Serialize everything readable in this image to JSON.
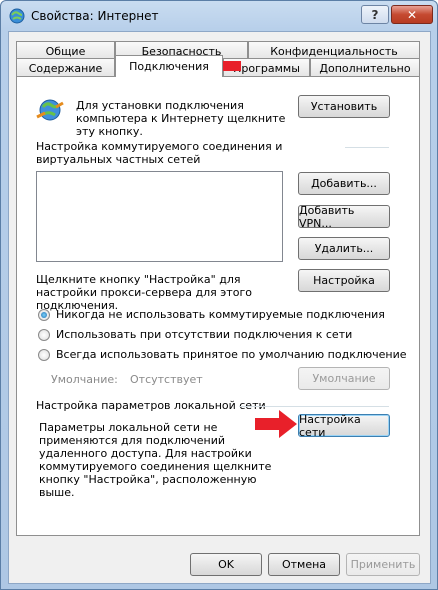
{
  "window": {
    "title": "Свойства: Интернет"
  },
  "titlebar": {
    "help_glyph": "?",
    "close_glyph": "✕"
  },
  "tabs": {
    "row1": [
      "Общие",
      "Безопасность",
      "Конфиденциальность"
    ],
    "row2": [
      "Содержание",
      "Подключения",
      "Программы",
      "Дополнительно"
    ],
    "active": "Подключения"
  },
  "setup": {
    "text": "Для установки подключения компьютера к Интернету щелкните эту кнопку.",
    "button": "Установить"
  },
  "dialup": {
    "header": "Настройка коммутируемого соединения и виртуальных частных сетей",
    "add_button": "Добавить...",
    "add_vpn_button": "Добавить VPN...",
    "remove_button": "Удалить...",
    "hint": "Щелкните кнопку \"Настройка\" для настройки прокси-сервера для этого подключения.",
    "settings_button": "Настройка",
    "radio_never": "Никогда не использовать коммутируемые подключения",
    "radio_when_absent": "Использовать при отсутствии подключения к сети",
    "radio_always": "Всегда использовать принятое по умолчанию подключение",
    "default_label": "Умолчание:",
    "default_value": "Отсутствует",
    "default_button": "Умолчание"
  },
  "lan": {
    "header": "Настройка параметров локальной сети",
    "text": "Параметры локальной сети не применяются для подключений удаленного доступа. Для настройки коммутируемого соединения щелкните кнопку \"Настройка\", расположенную выше.",
    "button": "Настройка сети"
  },
  "footer": {
    "ok": "OK",
    "cancel": "Отмена",
    "apply": "Применить"
  },
  "colors": {
    "arrow": "#e8202a",
    "focus": "#3c7fb1",
    "title_bar": "#b7cfea"
  }
}
